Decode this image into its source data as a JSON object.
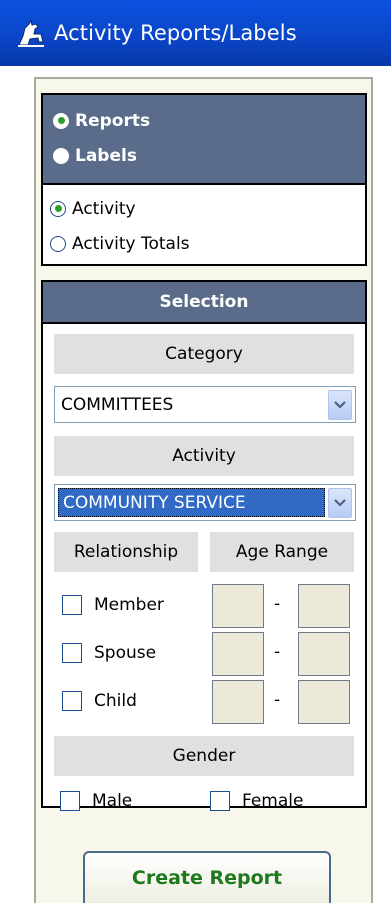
{
  "title": "Activity Reports/Labels",
  "output_type": {
    "options": [
      {
        "label": "Reports",
        "selected": true
      },
      {
        "label": "Labels",
        "selected": false
      }
    ]
  },
  "report_type": {
    "options": [
      {
        "label": "Activity",
        "selected": true
      },
      {
        "label": "Activity Totals",
        "selected": false
      }
    ]
  },
  "selection": {
    "header": "Selection",
    "category_label": "Category",
    "category_value": "COMMITTEES",
    "activity_label": "Activity",
    "activity_value": "COMMUNITY SERVICE",
    "relationship_label": "Relationship",
    "age_range_label": "Age Range",
    "relationships": [
      {
        "label": "Member",
        "checked": false
      },
      {
        "label": "Spouse",
        "checked": false
      },
      {
        "label": "Child",
        "checked": false
      }
    ],
    "age_separator": "-",
    "gender_label": "Gender",
    "genders": [
      {
        "label": "Male",
        "checked": false
      },
      {
        "label": "Female",
        "checked": false
      }
    ]
  },
  "create_button": "Create Report",
  "colors": {
    "titlebar": "#0a46c8",
    "header": "#5a6c8a",
    "button_text": "#1c7a1c",
    "selected_dot": "#2e9d2e",
    "highlight": "#316ac5"
  }
}
